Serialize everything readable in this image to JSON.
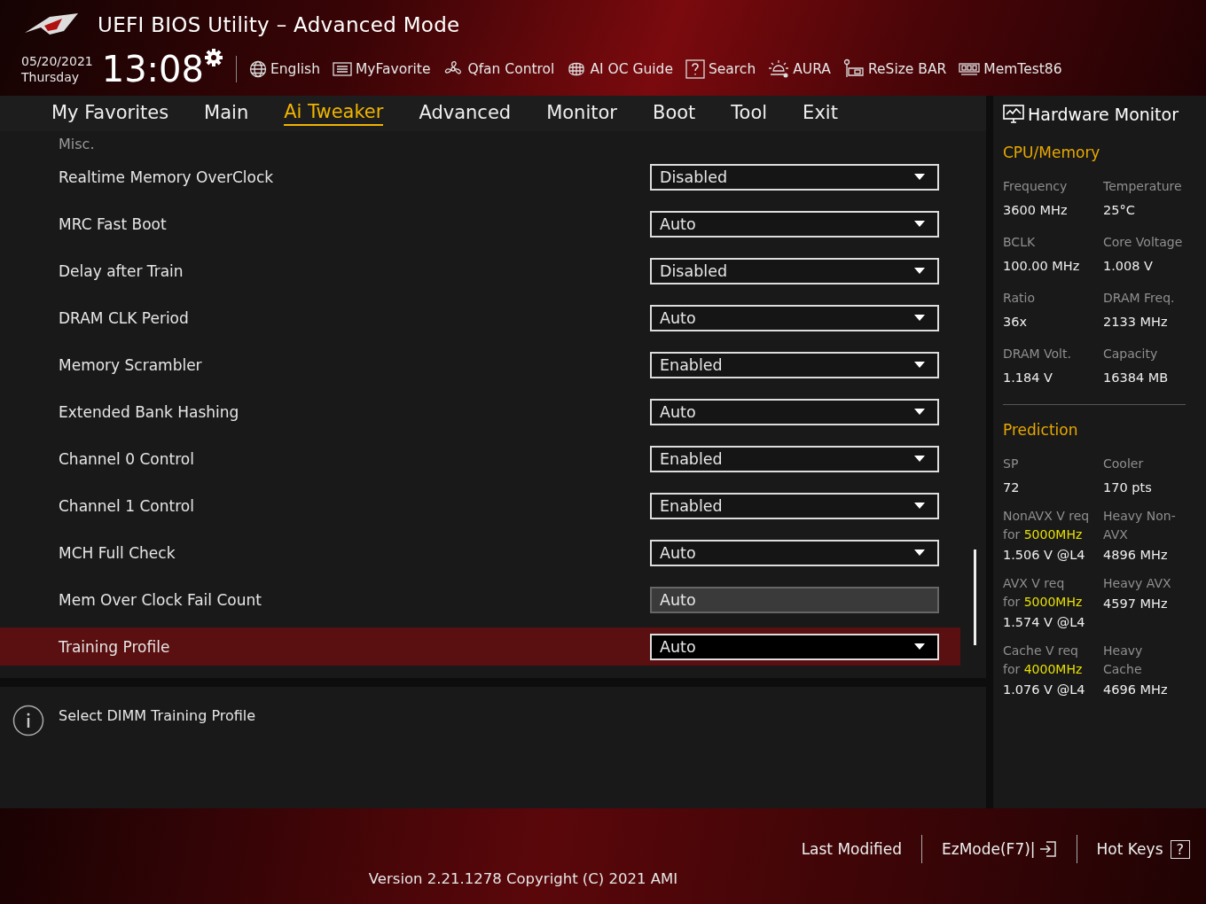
{
  "header": {
    "title": "UEFI BIOS Utility – Advanced Mode",
    "date": "05/20/2021",
    "day": "Thursday",
    "time": "13:08",
    "tools": [
      {
        "kind": "globe",
        "label": "English"
      },
      {
        "kind": "favorite",
        "label": "MyFavorite"
      },
      {
        "kind": "fan",
        "label": "Qfan Control"
      },
      {
        "kind": "chip",
        "label": "AI OC Guide"
      },
      {
        "kind": "help",
        "label": "Search"
      },
      {
        "kind": "aura",
        "label": "AURA"
      },
      {
        "kind": "card",
        "label": "ReSize BAR"
      },
      {
        "kind": "memory",
        "label": "MemTest86"
      }
    ]
  },
  "tabs": [
    {
      "label": "My Favorites",
      "selected": false
    },
    {
      "label": "Main",
      "selected": false
    },
    {
      "label": "Ai Tweaker",
      "selected": true
    },
    {
      "label": "Advanced",
      "selected": false
    },
    {
      "label": "Monitor",
      "selected": false
    },
    {
      "label": "Boot",
      "selected": false
    },
    {
      "label": "Tool",
      "selected": false
    },
    {
      "label": "Exit",
      "selected": false
    }
  ],
  "section": "Misc.",
  "settings": [
    {
      "label": "Realtime Memory OverClock",
      "value": "Disabled",
      "kind": "dropdown",
      "selected": false
    },
    {
      "label": "MRC Fast Boot",
      "value": "Auto",
      "kind": "dropdown",
      "selected": false
    },
    {
      "label": "Delay after Train",
      "value": "Disabled",
      "kind": "dropdown",
      "selected": false
    },
    {
      "label": "DRAM CLK Period",
      "value": "Auto",
      "kind": "dropdown",
      "selected": false
    },
    {
      "label": "Memory Scrambler",
      "value": "Enabled",
      "kind": "dropdown",
      "selected": false
    },
    {
      "label": "Extended Bank Hashing",
      "value": "Auto",
      "kind": "dropdown",
      "selected": false
    },
    {
      "label": "Channel 0 Control",
      "value": "Enabled",
      "kind": "dropdown",
      "selected": false
    },
    {
      "label": "Channel 1 Control",
      "value": "Enabled",
      "kind": "dropdown",
      "selected": false
    },
    {
      "label": "MCH Full Check",
      "value": "Auto",
      "kind": "dropdown",
      "selected": false
    },
    {
      "label": "Mem Over Clock Fail Count",
      "value": "Auto",
      "kind": "readonly",
      "selected": false
    },
    {
      "label": "Training Profile",
      "value": "Auto",
      "kind": "dropdown",
      "selected": true
    }
  ],
  "help_text": "Select DIMM Training Profile",
  "hardware_monitor": {
    "title": "Hardware Monitor",
    "cpu_memory": {
      "title": "CPU/Memory",
      "items": [
        {
          "label": "Frequency",
          "value": "3600 MHz"
        },
        {
          "label": "Temperature",
          "value": "25°C"
        },
        {
          "label": "BCLK",
          "value": "100.00 MHz"
        },
        {
          "label": "Core Voltage",
          "value": "1.008 V"
        },
        {
          "label": "Ratio",
          "value": "36x"
        },
        {
          "label": "DRAM Freq.",
          "value": "2133 MHz"
        },
        {
          "label": "DRAM Volt.",
          "value": "1.184 V"
        },
        {
          "label": "Capacity",
          "value": "16384 MB"
        }
      ]
    },
    "prediction": {
      "title": "Prediction",
      "sp": {
        "label": "SP",
        "value": "72"
      },
      "cooler": {
        "label": "Cooler",
        "value": "170 pts"
      },
      "rows": [
        {
          "label": "NonAVX V req for",
          "freq": "5000MHz",
          "value": "1.506 V @L4",
          "heavy_label": "Heavy Non-AVX",
          "heavy_value": "4896 MHz"
        },
        {
          "label": "AVX V req    for",
          "freq": "5000MHz",
          "value": "1.574 V @L4",
          "heavy_label": "Heavy AVX",
          "heavy_value": "4597 MHz"
        },
        {
          "label": "Cache V req for",
          "freq": "4000MHz",
          "value": "1.076 V @L4",
          "heavy_label": "Heavy Cache",
          "heavy_value": "4696 MHz"
        }
      ]
    }
  },
  "footer": {
    "last_modified": "Last Modified",
    "ezmode": "EzMode(F7)|",
    "hotkeys": "Hot Keys",
    "hotkeys_key": "?",
    "version": "Version 2.21.1278 Copyright (C) 2021 AMI"
  }
}
